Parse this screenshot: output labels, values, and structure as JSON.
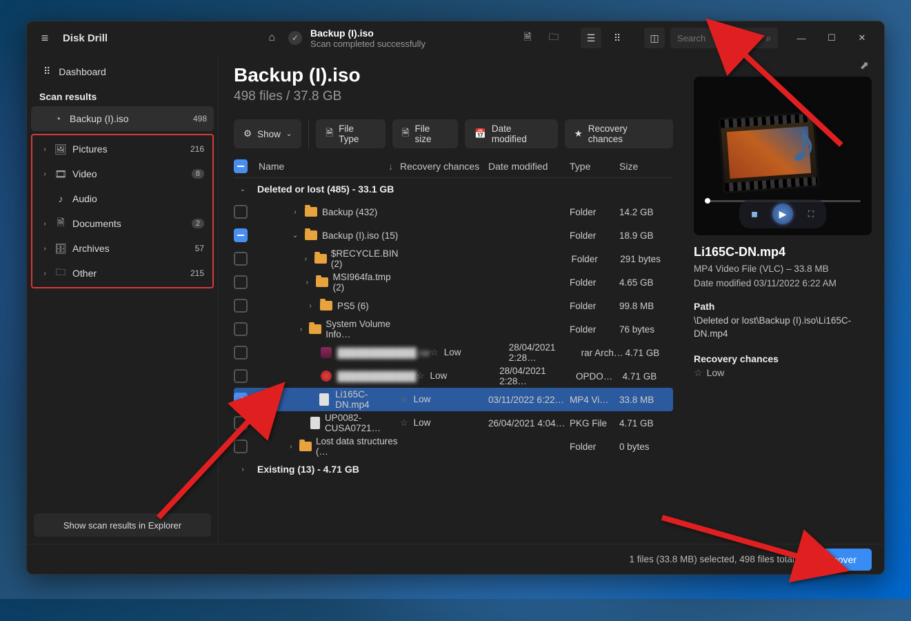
{
  "app_title": "Disk Drill",
  "dashboard_label": "Dashboard",
  "scan_results_header": "Scan results",
  "sidebar_root": {
    "label": "Backup (I).iso",
    "count": "498"
  },
  "sidebar_items": [
    {
      "label": "Pictures",
      "count": "216",
      "icon": "picture"
    },
    {
      "label": "Video",
      "count": "8",
      "icon": "video",
      "round": true
    },
    {
      "label": "Audio",
      "count": "",
      "icon": "audio",
      "nochv": true
    },
    {
      "label": "Documents",
      "count": "2",
      "icon": "document",
      "round": true
    },
    {
      "label": "Archives",
      "count": "57",
      "icon": "archive"
    },
    {
      "label": "Other",
      "count": "215",
      "icon": "other"
    }
  ],
  "sidebar_footer_btn": "Show scan results in Explorer",
  "titlebar": {
    "title": "Backup (I).iso",
    "subtitle": "Scan completed successfully",
    "search_placeholder": "Search"
  },
  "main": {
    "heading": "Backup (I).iso",
    "subhead": "498 files / 37.8 GB",
    "filters": {
      "show": "Show",
      "filetype": "File Type",
      "filesize": "File size",
      "datemod": "Date modified",
      "recovery": "Recovery chances"
    },
    "columns": {
      "name": "Name",
      "recovery": "Recovery chances",
      "date": "Date modified",
      "type": "Type",
      "size": "Size"
    },
    "group1": "Deleted or lost (485) - 33.1 GB",
    "group2": "Existing (13) - 4.71 GB",
    "rows": [
      {
        "lvl": 1,
        "chv": "›",
        "kind": "folder",
        "name": "Backup (432)",
        "rec": "",
        "date": "",
        "type": "Folder",
        "size": "14.2 GB"
      },
      {
        "lvl": 1,
        "chv": "⌄",
        "kind": "folder",
        "name": "Backup (I).iso (15)",
        "rec": "",
        "date": "",
        "type": "Folder",
        "size": "18.9 GB",
        "mix": true
      },
      {
        "lvl": 2,
        "chv": "›",
        "kind": "folder",
        "name": "$RECYCLE.BIN (2)",
        "rec": "",
        "date": "",
        "type": "Folder",
        "size": "291 bytes"
      },
      {
        "lvl": 2,
        "chv": "›",
        "kind": "folder",
        "name": "MSI964fa.tmp (2)",
        "rec": "",
        "date": "",
        "type": "Folder",
        "size": "4.65 GB"
      },
      {
        "lvl": 2,
        "chv": "›",
        "kind": "folder",
        "name": "PS5 (6)",
        "rec": "",
        "date": "",
        "type": "Folder",
        "size": "99.8 MB"
      },
      {
        "lvl": 2,
        "chv": "›",
        "kind": "folder",
        "name": "System Volume Info…",
        "rec": "",
        "date": "",
        "type": "Folder",
        "size": "76 bytes"
      },
      {
        "lvl": 2,
        "chv": "",
        "kind": "rar",
        "name": "████████████.rar",
        "rec": "Low",
        "date": "28/04/2021 2:28…",
        "type": "rar Arch…",
        "size": "4.71 GB",
        "blur": true
      },
      {
        "lvl": 2,
        "chv": "",
        "kind": "opd",
        "name": "████████████",
        "rec": "Low",
        "date": "28/04/2021 2:28…",
        "type": "OPDO…",
        "size": "4.71 GB",
        "blur": true
      },
      {
        "lvl": 2,
        "chv": "",
        "kind": "mp4",
        "name": "Li165C-DN.mp4",
        "rec": "Low",
        "date": "03/11/2022 6:22…",
        "type": "MP4 Vi…",
        "size": "33.8 MB",
        "sel": true,
        "chk": true
      },
      {
        "lvl": 2,
        "chv": "",
        "kind": "pkg",
        "name": "UP0082-CUSA0721…",
        "rec": "Low",
        "date": "26/04/2021 4:04…",
        "type": "PKG File",
        "size": "4.71 GB"
      },
      {
        "lvl": 1,
        "chv": "›",
        "kind": "folder",
        "name": "Lost data structures (…",
        "rec": "",
        "date": "",
        "type": "Folder",
        "size": "0 bytes"
      }
    ]
  },
  "preview": {
    "name": "Li165C-DN.mp4",
    "meta1": "MP4 Video File (VLC) – 33.8 MB",
    "meta2": "Date modified 03/11/2022 6:22 AM",
    "path_h": "Path",
    "path_v": "\\Deleted or lost\\Backup (I).iso\\Li165C-DN.mp4",
    "rec_h": "Recovery chances",
    "rec_v": "Low"
  },
  "footer": {
    "status": "1 files (33.8 MB) selected, 498 files total",
    "recover": "Recover"
  }
}
